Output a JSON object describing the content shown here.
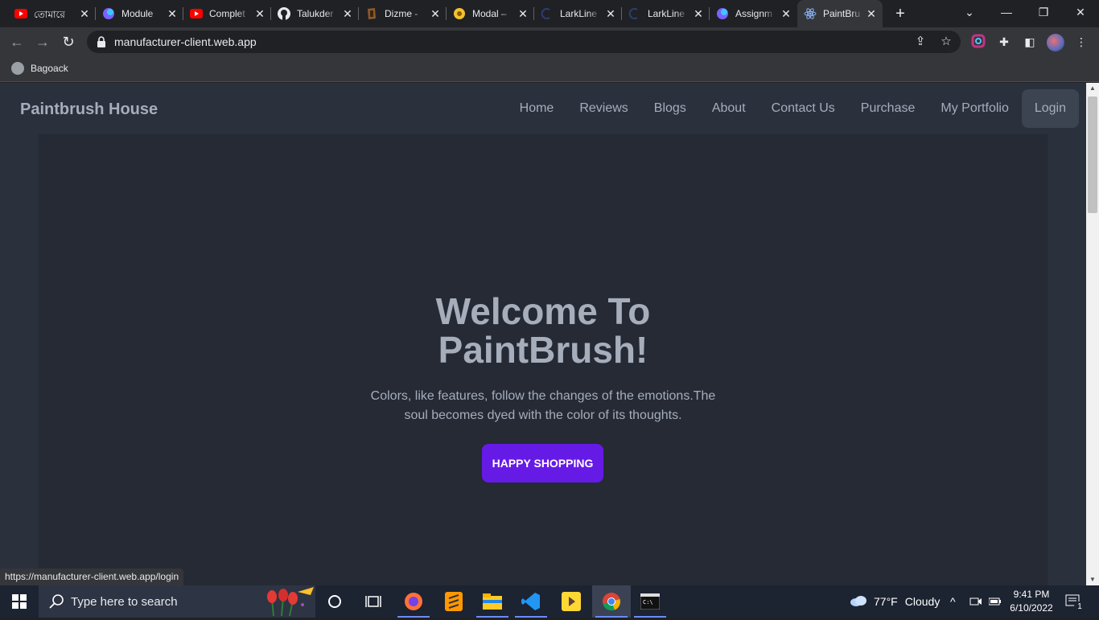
{
  "browser": {
    "tabs": [
      {
        "title": "তোমারে"
      },
      {
        "title": "Module"
      },
      {
        "title": "Complet"
      },
      {
        "title": "Talukder"
      },
      {
        "title": "Dizme -"
      },
      {
        "title": "Modal –"
      },
      {
        "title": "LarkLine"
      },
      {
        "title": "LarkLine"
      },
      {
        "title": "Assignm"
      },
      {
        "title": "PaintBru"
      }
    ],
    "url": "manufacturer-client.web.app",
    "bookmark": "Bagoack",
    "status_url": "https://manufacturer-client.web.app/login"
  },
  "site": {
    "brand": "Paintbrush House",
    "nav": [
      "Home",
      "Reviews",
      "Blogs",
      "About",
      "Contact Us",
      "Purchase",
      "My Portfolio",
      "Login"
    ],
    "hero": {
      "title_line1": "Welcome To",
      "title_line2": "PaintBrush!",
      "subtitle": "Colors, like features, follow the changes of the emotions.The soul becomes dyed with the color of its thoughts.",
      "cta": "HAPPY SHOPPING"
    },
    "colors": {
      "accent": "#661ae6",
      "page_bg": "#2a303c",
      "hero_bg": "#252a35",
      "text": "#a6adbb"
    }
  },
  "taskbar": {
    "search_placeholder": "Type here to search",
    "weather_temp": "77°F",
    "weather_desc": "Cloudy",
    "time": "9:41 PM",
    "date": "6/10/2022",
    "notification_count": "1"
  }
}
